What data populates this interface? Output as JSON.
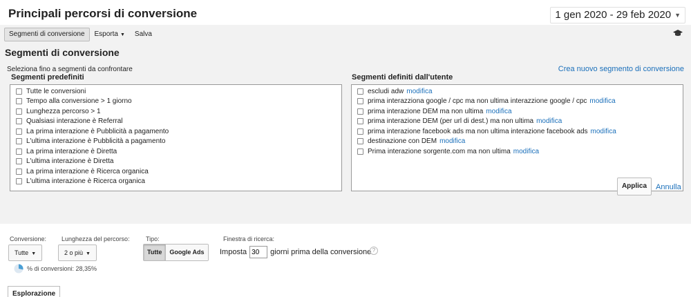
{
  "header": {
    "title": "Principali percorsi di conversione",
    "date_range": "1 gen 2020 - 29 feb 2020"
  },
  "toolbar": {
    "segments_label": "Segmenti di conversione",
    "export_label": "Esporta",
    "save_label": "Salva"
  },
  "segments": {
    "title": "Segmenti di conversione",
    "hint": "Seleziona fino a segmenti da confrontare",
    "create_link": "Crea nuovo segmento di conversione",
    "predefined_heading": "Segmenti predefiniti",
    "predefined": [
      "Tutte le conversioni",
      "Tempo alla conversione > 1 giorno",
      "Lunghezza percorso > 1",
      "Qualsiasi interazione è Referral",
      "La prima interazione è Pubblicità a pagamento",
      "L'ultima interazione è Pubblicità a pagamento",
      "La prima interazione è Diretta",
      "L'ultima interazione è Diretta",
      "La prima interazione è Ricerca organica",
      "L'ultima interazione è Ricerca organica"
    ],
    "user_heading": "Segmenti definiti dall'utente",
    "modify_label": "modifica",
    "user_defined": [
      "escludi adw",
      "prima interazziona google / cpc ma non ultima interazzione google / cpc",
      "prima interazione DEM ma non ultima",
      "prima interazione DEM (per url di dest.) ma non ultima",
      "prima interazione facebook ads ma non ultima interazione facebook ads",
      "destinazione con DEM",
      "Prima interazione sorgente.com ma non ultima"
    ],
    "apply_label": "Applica",
    "cancel_label": "Annulla"
  },
  "filters": {
    "conversion_label": "Conversione:",
    "conversion_value": "Tutte",
    "path_length_label": "Lunghezza del percorso:",
    "path_length_value": "2 o più",
    "type_label": "Tipo:",
    "type_all": "Tutte",
    "type_google_ads": "Google Ads",
    "lookback_label": "Finestra di ricerca:",
    "lookback_prefix": "Imposta",
    "lookback_value": "30",
    "lookback_suffix": "giorni prima della conversione",
    "help_glyph": "?",
    "pct_text": "% di conversioni: 28,35%",
    "pct_value": 28.35
  },
  "tabs": {
    "explore_label": "Esplorazione"
  },
  "colors": {
    "link": "#1a6fba",
    "pie": "#4a9fd5"
  }
}
